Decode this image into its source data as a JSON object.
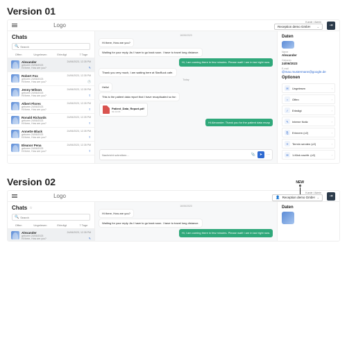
{
  "labels": {
    "version": "Version",
    "v1": "01",
    "v2": "02",
    "new": "NEW"
  },
  "topbar": {
    "logo": "Logo",
    "kundeLabel": "Kunde / Admin",
    "kundeValue": "Reception demo GmbH",
    "exitGlyph": "⇥"
  },
  "left": {
    "title": "Chats",
    "searchPlaceholder": "Search",
    "filters": [
      "Offen",
      "Ungelesen",
      "Erledigt",
      "7 Tage"
    ],
    "items": [
      {
        "name": "Alexander",
        "sub": "geboren 24/06/2023",
        "preview": "Hi there, How are you?",
        "time": "24/06/2023, 12.35 PM",
        "icon": "✎",
        "sel": true
      },
      {
        "name": "Robert Fox",
        "sub": "geboren 24/06/2023",
        "preview": "Hi there, How are you?",
        "time": "24/06/2023, 12.35 PM",
        "icon": "🕐"
      },
      {
        "name": "Jenny Wilson",
        "sub": "geboren 24/06/2023",
        "preview": "Hi there, How are you?",
        "time": "24/06/2023, 12.35 PM",
        "icon": "⇪"
      },
      {
        "name": "Albert Flores",
        "sub": "geboren 24/06/2023",
        "preview": "Hi there, How are you?",
        "time": "24/06/2023, 12.35 PM",
        "icon": "⇪"
      },
      {
        "name": "Ronald Richards",
        "sub": "geboren 24/06/2023",
        "preview": "Hi there, How are you?",
        "time": "24/06/2023, 12.35 PM",
        "icon": "⇪"
      },
      {
        "name": "Annette Black",
        "sub": "geboren 24/06/2023",
        "preview": "Hi there, How are you?",
        "time": "24/06/2023, 12.35 PM",
        "icon": "⇪"
      },
      {
        "name": "Eleanor Pena",
        "sub": "geboren 24/06/2023",
        "preview": "Hi there, How are you?",
        "time": "24/06/2023, 12.35 PM",
        "icon": "⇪"
      }
    ]
  },
  "chat": {
    "day1": "16/06/2023",
    "b1": "Hi there, How are you?",
    "b2": "Waiting for your reply. As I have to go back soon. I have to travel long distance.",
    "b3": "Hi, I am coming there in few minutes. Please wait! I am in taxi right now.",
    "b4": "Thank you very much, I am waiting here at StarBuck cafe.",
    "day2": "Today",
    "b5": "Hello!",
    "b6": "This is the patient data report that I have recapituated so far:",
    "fileName": "Patient_Data_Report.pdf",
    "fileSize": "99.30 KB",
    "b7": "Hi Alexander. Thank you for the patient data recap",
    "composerPlaceholder": "Nachricht schreiben..."
  },
  "right": {
    "title": "Daten",
    "nameLabel": "Name",
    "nameValue": "Alexander",
    "dateLabel": "Geboren",
    "dateValue": "24/06/2023",
    "emailLabel": "E-mail",
    "emailValue": "@max.mustermann@google.de",
    "optTitle": "Optionen",
    "options": [
      {
        "icon": "✉",
        "label": "Ungelesen"
      },
      {
        "icon": "○",
        "label": "Offen"
      },
      {
        "icon": "✓",
        "label": "Erledigt"
      },
      {
        "icon": "✎",
        "label": "Interne Notiz"
      },
      {
        "icon": "⎘",
        "label": "Erinnern (v2)"
      },
      {
        "icon": "✈",
        "label": "Termin senden (v2)"
      },
      {
        "icon": "✉",
        "label": "1-Klick nachfr. (v2)"
      }
    ]
  }
}
